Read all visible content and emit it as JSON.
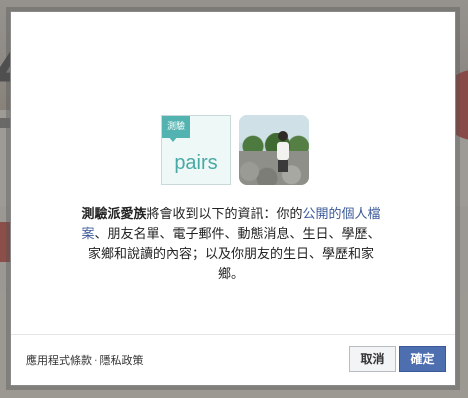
{
  "app_tile": {
    "badge": "測驗",
    "brand": "pairs"
  },
  "permission": {
    "app_name": "測驗派愛族",
    "lead": "將會收到以下的資訊：你的",
    "profile_link": "公開的個人檔案",
    "rest": "、朋友名單、電子郵件、動態消息、生日、學歷、家鄉和說讀的內容；以及你朋友的生日、學歷和家鄉。"
  },
  "footer": {
    "terms_link": "應用程式條款",
    "separator": "·",
    "privacy_link": "隱私政策",
    "cancel_label": "取消",
    "confirm_label": "確定"
  }
}
